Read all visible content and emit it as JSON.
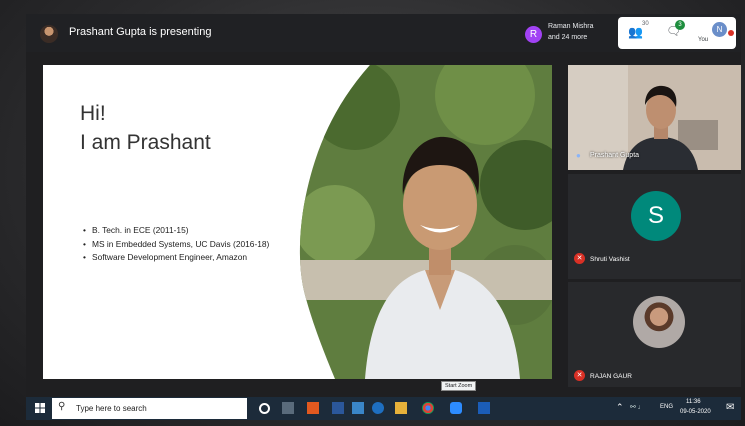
{
  "meet": {
    "presenting_text": "Prashant Gupta is presenting",
    "participants_line1": "Raman Mishra",
    "participants_line2": "and 24 more",
    "participants_initial": "R",
    "people_count": "30",
    "chat_count": "3",
    "you_label": "You",
    "you_initial": "N"
  },
  "slide": {
    "title_line1": "Hi!",
    "title_line2": "I am Prashant",
    "bullets": [
      "B. Tech. in ECE (2011-15)",
      "MS in Embedded Systems, UC Davis (2016-18)",
      "Software Development Engineer, Amazon"
    ]
  },
  "tiles": [
    {
      "name": "Prashant Gupta"
    },
    {
      "name": "Shruti Vashist",
      "initial": "S"
    },
    {
      "name": "RAJAN GAUR"
    }
  ],
  "tooltip": "Start Zoom",
  "taskbar": {
    "search_placeholder": "Type here to search",
    "lang": "ENG",
    "time": "11:36",
    "date": "09-05-2020"
  },
  "colors": {
    "meet_bg": "#202124",
    "accent_green": "#1e8e3e",
    "tile_avatar_teal": "#00897b",
    "mic_off_red": "#d93025",
    "taskbar_bg": "#1c2b3a"
  }
}
